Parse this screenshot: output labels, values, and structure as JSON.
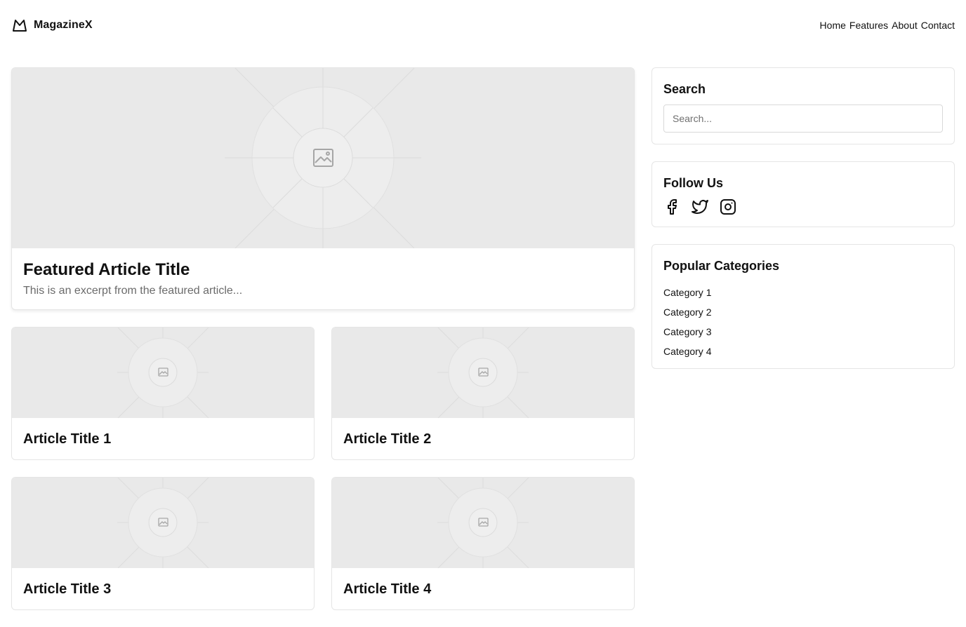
{
  "brand": {
    "name": "MagazineX",
    "logo_icon": "mountain-logo-icon"
  },
  "nav": {
    "items": [
      {
        "label": "Home"
      },
      {
        "label": "Features"
      },
      {
        "label": "About"
      },
      {
        "label": "Contact"
      }
    ]
  },
  "featured": {
    "title": "Featured Article Title",
    "excerpt": "This is an excerpt from the featured article...",
    "image_icon": "image-placeholder-icon"
  },
  "articles": [
    {
      "title": "Article Title 1",
      "image_icon": "image-placeholder-icon"
    },
    {
      "title": "Article Title 2",
      "image_icon": "image-placeholder-icon"
    },
    {
      "title": "Article Title 3",
      "image_icon": "image-placeholder-icon"
    },
    {
      "title": "Article Title 4",
      "image_icon": "image-placeholder-icon"
    }
  ],
  "sidebar": {
    "search": {
      "title": "Search",
      "placeholder": "Search...",
      "value": ""
    },
    "follow": {
      "title": "Follow Us",
      "icons": [
        "facebook-icon",
        "twitter-icon",
        "instagram-icon"
      ]
    },
    "categories": {
      "title": "Popular Categories",
      "items": [
        "Category 1",
        "Category 2",
        "Category 3",
        "Category 4"
      ]
    }
  },
  "colors": {
    "text": "#111111",
    "muted": "#6b6b6b",
    "border": "#e5e5e5",
    "placeholder_bg": "#e9e9e9"
  }
}
